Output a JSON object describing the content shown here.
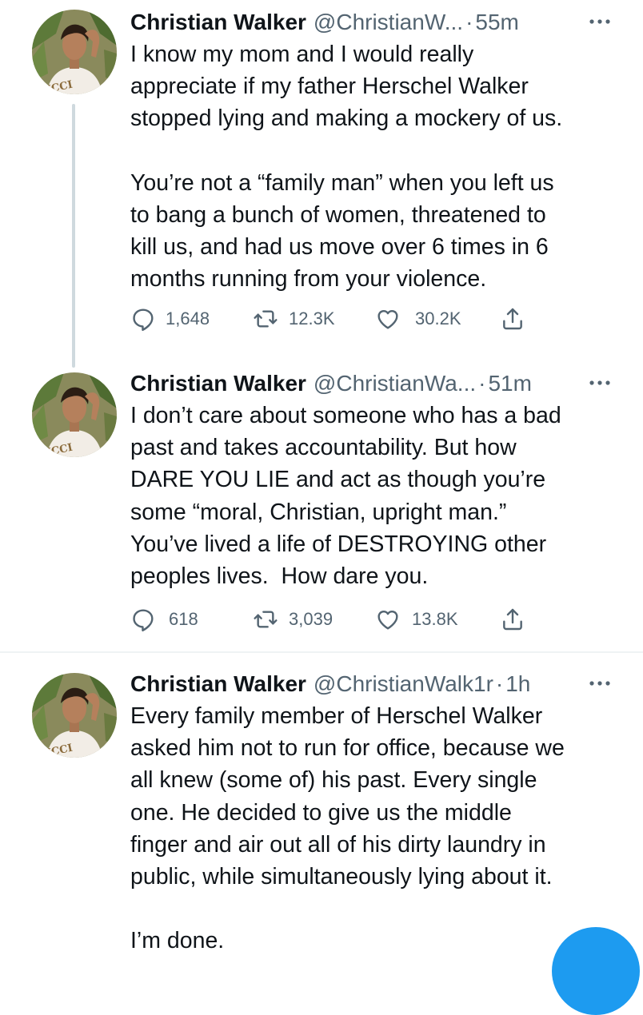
{
  "tweets": [
    {
      "author_name": "Christian Walker",
      "handle": "@ChristianW...",
      "separator": "·",
      "time": "55m",
      "text": "I know my mom and I would really\nappreciate if my father Herschel Walker\nstopped lying and making a mockery of us.\n\nYou’re not a “family man” when you left us\nto bang a bunch of women, threatened to\nkill us, and had us move over 6 times in 6\nmonths running from your violence.",
      "replies": "1,648",
      "retweets": "12.3K",
      "likes": "30.2K"
    },
    {
      "author_name": "Christian Walker",
      "handle": "@ChristianWa...",
      "separator": "·",
      "time": "51m",
      "text": "I don’t care about someone who has a bad\npast and takes accountability. But how\nDARE YOU LIE and act as though you’re\nsome “moral, Christian, upright man.”\nYou’ve lived a life of DESTROYING other\npeoples lives.  How dare you.",
      "replies": "618",
      "retweets": "3,039",
      "likes": "13.8K"
    },
    {
      "author_name": "Christian Walker",
      "handle": "@ChristianWalk1r",
      "separator": "·",
      "time": "1h",
      "text": "Every family member of Herschel Walker\nasked him not to run for office, because we\nall knew (some of) his past. Every single\none. He decided to give us the middle\nfinger and air out all of his dirty laundry in\npublic, while simultaneously lying about it.\n\nI’m done."
    }
  ],
  "icons": {
    "reply": "reply-icon",
    "retweet": "retweet-icon",
    "like": "heart-icon",
    "share": "share-icon",
    "more": "more-icon",
    "compose": "compose-button"
  },
  "colors": {
    "text": "#0f1419",
    "secondary": "#536471",
    "thread_line": "#cfd9de",
    "divider": "#eff3f4",
    "accent": "#1d9bf0"
  }
}
